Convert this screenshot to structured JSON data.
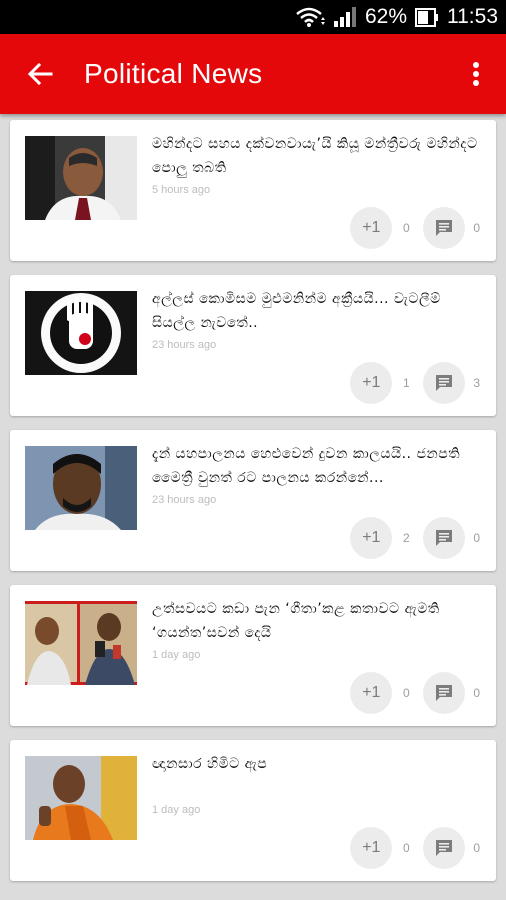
{
  "status_bar": {
    "battery_percent": "62%",
    "time": "11:53",
    "icons": [
      "wifi-icon",
      "signal-icon",
      "battery-icon"
    ]
  },
  "app_bar": {
    "title": "Political News",
    "back_icon": "arrow-back-icon",
    "menu_icon": "more-vert-icon",
    "color": "#e4080a"
  },
  "articles": [
    {
      "headline": "මහින්දට සහය දක්වනවායැ’යි කියූ මන්ත්‍රීවරු මහින්දට පොලු තබති",
      "time": "5 hours ago",
      "plus_label": "+1",
      "plus_count": "0",
      "comment_count": "0"
    },
    {
      "headline": "අල්ලස් කොමිසම මුළුමනින්ම අක්‍රීයයි... වැටලීම් සියල්ල නැවතේ..",
      "time": "23 hours ago",
      "plus_label": "+1",
      "plus_count": "1",
      "comment_count": "3"
    },
    {
      "headline": "දැන් යහපාලනය හෙළුවෙන් දුවන කාලයයි.. ජනපති මෛත්‍රී වුනත් රට පාලනය කරන්නේ...",
      "time": "23 hours ago",
      "plus_label": "+1",
      "plus_count": "2",
      "comment_count": "0"
    },
    {
      "headline": "උත්සවයට කඩා පැන ‘ගීතා’කළ කතාවට ඇමති ‘ගයන්ත’සවන් දෙයි",
      "time": "1 day ago",
      "plus_label": "+1",
      "plus_count": "0",
      "comment_count": "0"
    },
    {
      "headline": "ඥානසාර හිමිට ඇප",
      "time": "1 day ago",
      "plus_label": "+1",
      "plus_count": "0",
      "comment_count": "0"
    }
  ]
}
